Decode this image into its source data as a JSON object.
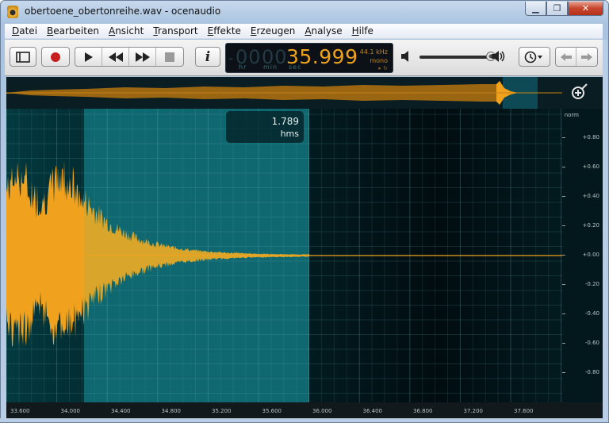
{
  "window": {
    "title": "obertoene_obertonreihe.wav - ocenaudio",
    "minimize": "▁",
    "maximize": "❐",
    "close": "✕"
  },
  "menu": [
    {
      "label": "Datei",
      "u": "D",
      "rest": "atei"
    },
    {
      "label": "Bearbeiten",
      "u": "B",
      "rest": "earbeiten"
    },
    {
      "label": "Ansicht",
      "u": "A",
      "rest": "nsicht"
    },
    {
      "label": "Transport",
      "u": "T",
      "rest": "ransport"
    },
    {
      "label": "Effekte",
      "u": "E",
      "rest": "ffekte"
    },
    {
      "label": "Erzeugen",
      "u": "E",
      "rest": "rzeugen"
    },
    {
      "label": "Analyse",
      "u": "A",
      "rest": "nalyse"
    },
    {
      "label": "Hilfe",
      "u": "H",
      "rest": "ilfe"
    }
  ],
  "toolbar": {
    "icons": [
      "sidebar-toggle-icon",
      "record-icon",
      "play-icon",
      "rewind-icon",
      "fast-forward-icon",
      "stop-icon",
      "info-icon",
      "volume-low-icon",
      "volume-high-icon",
      "history-clock-icon",
      "arrow-left-icon",
      "arrow-right-icon"
    ],
    "info_label": "i"
  },
  "time_display": {
    "hours": "00",
    "minutes": "00",
    "seconds": "35.999",
    "dim_prefix": "-",
    "unit_hr": "hr",
    "unit_min": "min",
    "unit_sec": "sec",
    "sample_rate": "44.1 kHz",
    "channels": "mono",
    "loop_glyph": "▸ ↻"
  },
  "volume": {
    "level": 0.93
  },
  "selection_tooltip": {
    "value": "1.789",
    "unit": "hms"
  },
  "amplitude_scale": {
    "header": "norm",
    "labels": [
      "+0.80",
      "+0.60",
      "+0.40",
      "+0.20",
      "+0.00",
      "-0.20",
      "-0.40",
      "-0.60",
      "-0.80"
    ]
  },
  "timeline": {
    "labels": [
      "33.600",
      "34.000",
      "34.400",
      "34.800",
      "35.200",
      "35.600",
      "36.000",
      "36.400",
      "36.800",
      "37.200",
      "37.600"
    ]
  },
  "colors": {
    "waveform": "#f0a21e",
    "waveform_selected": "#d9a52a",
    "background": "#04383f",
    "selection": "#0f6c75",
    "dark_region": "#02181c"
  }
}
